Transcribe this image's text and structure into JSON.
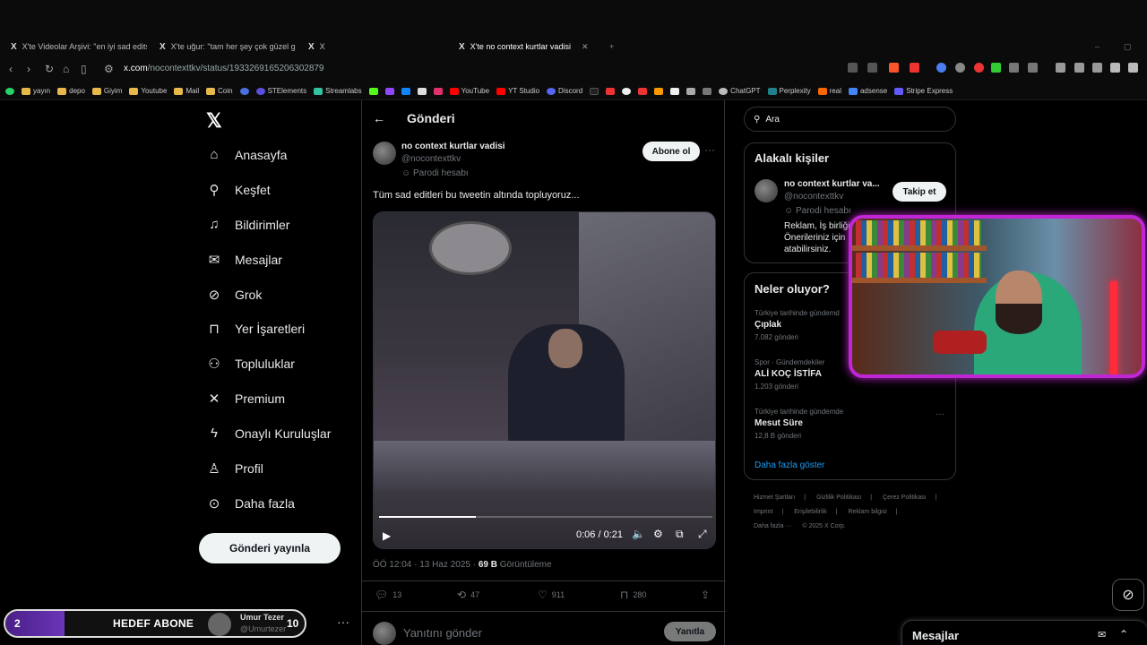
{
  "tabs": [
    {
      "label": "X'te Videolar Arşivi: \"en iyi sad edits"
    },
    {
      "label": "X'te uğur: \"tam her şey çok güzel gidi"
    },
    {
      "label": "X"
    },
    {
      "label": "X'te no context kurtlar vadisi"
    }
  ],
  "url": {
    "host": "x.com",
    "path": "/nocontexttkv/status/1933269165206302879"
  },
  "bookmarks": [
    "yayın",
    "depo",
    "Giyim",
    "Youtube",
    "Mail",
    "Coin",
    "STElements",
    "Streamlabs",
    "YouTube",
    "YT Studio",
    "Discord",
    "ChatGPT",
    "Perplexity",
    "real",
    "adsense",
    "Stripe Express"
  ],
  "nav": [
    {
      "label": "Anasayfa",
      "icon": "home-icon",
      "glyph": "⌂"
    },
    {
      "label": "Keşfet",
      "icon": "search-icon",
      "glyph": "⚲"
    },
    {
      "label": "Bildirimler",
      "icon": "bell-icon",
      "glyph": "♫"
    },
    {
      "label": "Mesajlar",
      "icon": "mail-icon",
      "glyph": "✉"
    },
    {
      "label": "Grok",
      "icon": "grok-icon",
      "glyph": "⊘"
    },
    {
      "label": "Yer İşaretleri",
      "icon": "bookmark-icon",
      "glyph": "⊓"
    },
    {
      "label": "Topluluklar",
      "icon": "people-icon",
      "glyph": "⚇"
    },
    {
      "label": "Premium",
      "icon": "x-icon",
      "glyph": "✕"
    },
    {
      "label": "Onaylı Kuruluşlar",
      "icon": "lightning-icon",
      "glyph": "ϟ"
    },
    {
      "label": "Profil",
      "icon": "user-icon",
      "glyph": "♙"
    },
    {
      "label": "Daha fazla",
      "icon": "more-circle-icon",
      "glyph": "⊙"
    }
  ],
  "post_button": "Gönderi yayınla",
  "goal_overlay": {
    "current": "2",
    "label": "HEDEF ABONE",
    "target": "10",
    "user_name": "Umur Tezer",
    "user_handle": "@Umurtezer"
  },
  "header": {
    "title": "Gönderi"
  },
  "tweet": {
    "author_name": "no context kurtlar vadisi",
    "author_handle": "@nocontexttkv",
    "parody_label": "Parodi hesabı",
    "subscribe_label": "Abone ol",
    "text": "Tüm sad editleri bu tweetin altında topluyoruz...",
    "video": {
      "current_time": "0:06",
      "duration": "0:21",
      "progress": 0.29
    },
    "time": "ÖÖ 12:04",
    "date": "13 Haz 2025",
    "views_count": "69 B",
    "views_label": "Görüntüleme",
    "replies": "13",
    "reposts": "47",
    "likes": "911",
    "bookmarks": "280"
  },
  "reply": {
    "placeholder": "Yanıtını gönder",
    "button": "Yanıtla"
  },
  "search": {
    "placeholder": "Ara"
  },
  "related": {
    "title": "Alakalı kişiler",
    "name": "no context kurtlar va...",
    "handle": "@nocontexttkv",
    "parody": "Parodi hesabı",
    "bio": "Reklam, İş birliği Önerileriniz için atabilirsiniz.",
    "follow": "Takip et"
  },
  "trends": {
    "title": "Neler oluyor?",
    "items": [
      {
        "context": "Türkiye tarihinde gündemd",
        "name": "Çıplak",
        "count": "7.082 gönderi"
      },
      {
        "context": "Spor · Gündemdekiler",
        "name": "ALİ KOÇ İSTİFA",
        "count": "1.203 gönderi"
      },
      {
        "context": "Türkiye tarihinde gündemde",
        "name": "Mesut Süre",
        "count": "12,8 B gönderi"
      }
    ],
    "show_more": "Daha fazla göster"
  },
  "footer": [
    "Hizmet Şartları",
    "Gizlilik Politikası",
    "Çerez Politikası",
    "Imprint",
    "Erişilebilirlik",
    "Reklam bilgisi",
    "Daha fazla ···",
    "© 2025 X Corp."
  ],
  "dm": {
    "title": "Mesajlar"
  },
  "colors": {
    "accent": "#1d9bf0",
    "background": "#000000",
    "webcam_border": "#c026d3"
  }
}
